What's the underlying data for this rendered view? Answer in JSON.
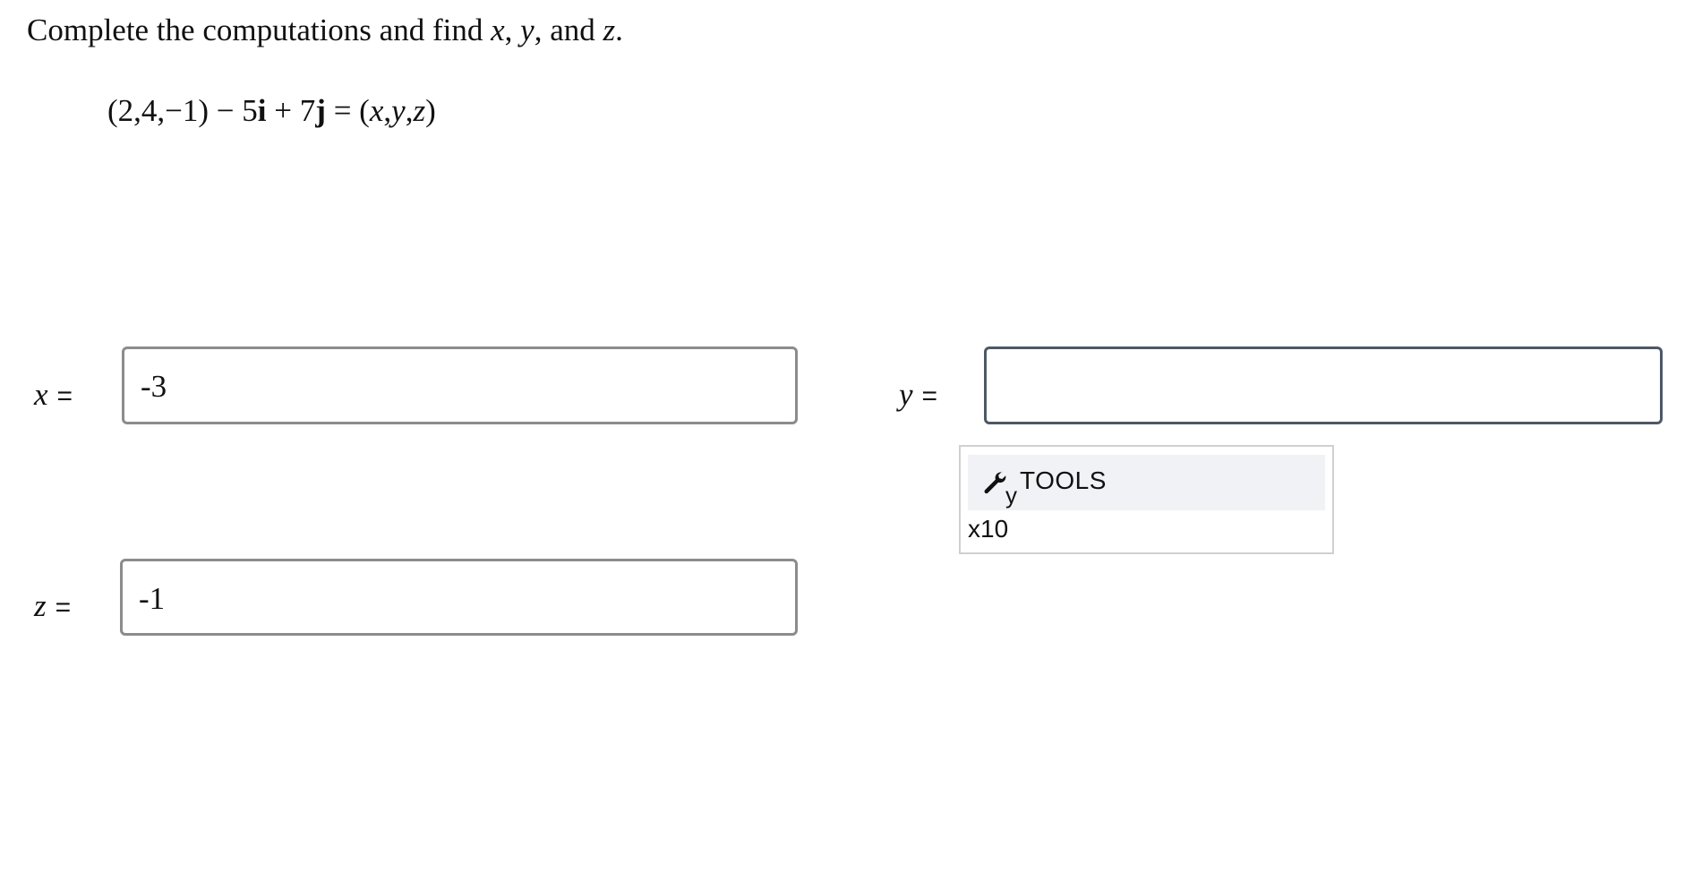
{
  "question": {
    "prefix": "Complete the computations and find ",
    "var_x": "x",
    "comma1": ", ",
    "var_y": "y",
    "comma2": ", and ",
    "var_z": "z",
    "suffix": "."
  },
  "equation": {
    "left": "(2,4,−1) − 5",
    "i": "i",
    "plus": " + 7",
    "j": "j",
    "equals": " = (",
    "x": "x",
    "c1": ",",
    "y": "y",
    "c2": ",",
    "z": "z",
    "close": ")"
  },
  "fields": {
    "x": {
      "label": "x",
      "eq": "=",
      "value": "-3"
    },
    "y": {
      "label": "y",
      "eq": "=",
      "value": ""
    },
    "z": {
      "label": "z",
      "eq": "=",
      "value": "-1"
    }
  },
  "tools_popup": {
    "tools_label": "TOOLS",
    "subscript_label": "y",
    "x10_label": "x10"
  },
  "colors": {
    "field_border": "#8c8c8c",
    "active_field_border": "#4d5866",
    "popup_header_bg": "#f1f2f6",
    "popup_border": "#d0d0d0"
  },
  "icons": {
    "tools": "wrench-icon"
  }
}
